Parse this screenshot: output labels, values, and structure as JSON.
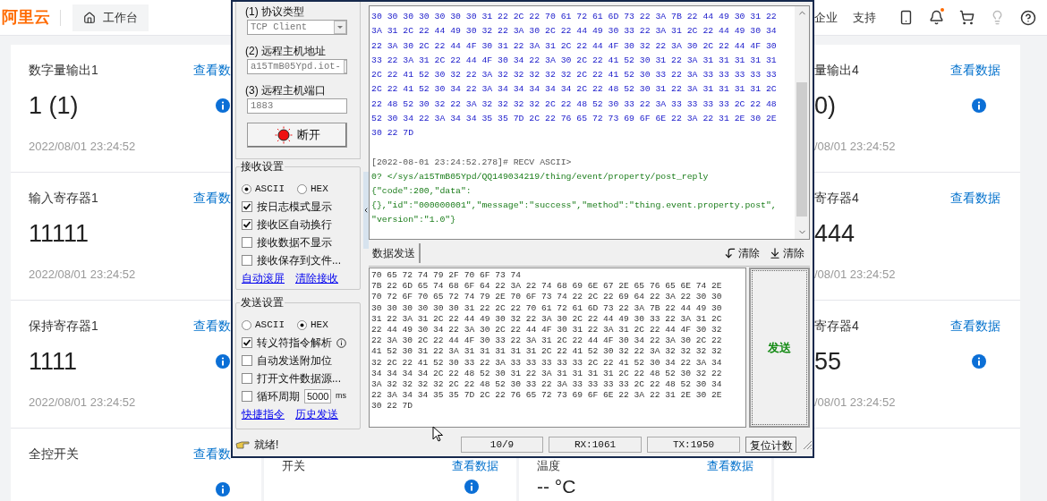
{
  "header": {
    "logo": "阿里云",
    "workbench": "工作台",
    "links": [
      "企业",
      "支持"
    ]
  },
  "left_cards": [
    {
      "title": "数字量输出1",
      "link": "查看数",
      "value": "1 (1)",
      "time": "2022/08/01 23:24:52",
      "info_icon": true
    },
    {
      "title": "输入寄存器1",
      "link": "查看数",
      "value": "11111",
      "time": "2022/08/01 23:24:52",
      "info_icon": false
    },
    {
      "title": "保持寄存器1",
      "link": "查看数",
      "value": "1111",
      "time": "2022/08/01 23:24:52",
      "info_icon": true
    },
    {
      "title": "全控开关",
      "link": "查看数",
      "info_icon": true
    }
  ],
  "right_cards": [
    {
      "title": "量输出4",
      "link": "查看数据",
      "value": "0)",
      "time": "/08/01 23:24:52",
      "info_icon": true
    },
    {
      "title": "寄存器4",
      "link": "查看数据",
      "value": "444",
      "time": "/08/01 23:24:52",
      "info_icon": false
    },
    {
      "title": "寄存器4",
      "link": "查看数据",
      "value": "55",
      "time": "/08/01 23:24:52",
      "info_icon": true
    }
  ],
  "bottom_cards": [
    {
      "title": "开关",
      "link": "查看数据",
      "info_icon": true
    },
    {
      "title": "温度",
      "link": "查看数据",
      "value": "-- °C",
      "info_icon": false
    }
  ],
  "tool": {
    "protocol_label": "(1) 协议类型",
    "protocol": "TCP Client",
    "host_label": "(2) 远程主机地址",
    "host": "a15TmB05Ypd.iot-",
    "port_label": "(3) 远程主机端口",
    "port": "1883",
    "connect_button": "断开",
    "lamp_on": true,
    "receive_settings": {
      "title": "接收设置",
      "modes": [
        {
          "label": "ASCII",
          "selected": true
        },
        {
          "label": "HEX",
          "selected": false
        }
      ],
      "options": [
        {
          "label": "按日志模式显示",
          "checked": true,
          "kind": "plain"
        },
        {
          "label": "接收区自动换行",
          "checked": true,
          "kind": "plain"
        },
        {
          "label": "接收数据不显示",
          "checked": false,
          "kind": "plain"
        },
        {
          "label": "接收保存到文件...",
          "checked": false,
          "kind": "plain"
        }
      ],
      "links": [
        "自动滚屏",
        "清除接收"
      ]
    },
    "send_settings": {
      "title": "发送设置",
      "modes": [
        {
          "label": "ASCII",
          "selected": false
        },
        {
          "label": "HEX",
          "selected": true
        }
      ],
      "options": [
        {
          "label": "转义符指令解析",
          "checked": true,
          "kind": "info"
        },
        {
          "label": "自动发送附加位",
          "checked": false,
          "kind": "plain"
        },
        {
          "label": "打开文件数据源...",
          "checked": false,
          "kind": "plain"
        },
        {
          "label": "循环周期",
          "checked": false,
          "kind": "period",
          "value": "5000",
          "unit": "ms"
        }
      ],
      "links": [
        "快捷指令",
        "历史发送"
      ]
    },
    "receive_log": {
      "hex_lines": [
        "30 30 30 30 30 30 30 31 22 2C 22 70 61 72 61 6D 73 22 3A 7B 22 44 49 30 31 22",
        "3A 31 2C 22 44 49 30 32 22 3A 30 2C 22 44 49 30 33 22 3A 31 2C 22 44 49 30 34",
        "22 3A 30 2C 22 44 4F 30 31 22 3A 31 2C 22 44 4F 30 32 22 3A 30 2C 22 44 4F 30",
        "33 22 3A 31 2C 22 44 4F 30 34 22 3A 30 2C 22 41 52 30 31 22 3A 31 31 31 31 31",
        "2C 22 41 52 30 32 22 3A 32 32 32 32 32 2C 22 41 52 30 33 22 3A 33 33 33 33 33",
        "2C 22 41 52 30 34 22 3A 34 34 34 34 34 2C 22 48 52 30 31 22 3A 31 31 31 31 2C",
        "22 48 52 30 32 22 3A 32 32 32 32 2C 22 48 52 30 33 22 3A 33 33 33 33 2C 22 48",
        "52 30 34 22 3A 34 34 35 35 7D 2C 22 76 65 72 73 69 6F 6E 22 3A 22 31 2E 30 2E",
        "30 22 7D"
      ],
      "header": "[2022-08-01 23:24:52.278]# RECV ASCII>",
      "ascii_lines": [
        "0? </sys/a15TmB05Ypd/QQ149034219/thing/event/property/post_reply",
        "{\"code\":200,\"data\":",
        "{},\"id\":\"000000001\",\"message\":\"success\",\"method\":\"thing.event.property.post\",",
        "\"version\":\"1.0\"}"
      ]
    },
    "send_tab": "数据发送",
    "clear_buttons": [
      {
        "label": "清除",
        "kind": "receive"
      },
      {
        "label": "清除",
        "kind": "send"
      }
    ],
    "send_lines": [
      "70 65 72 74 79 2F 70 6F 73 74",
      "7B 22 6D 65 74 68 6F 64 22 3A 22 74 68 69 6E 67 2E 65 76 65 6E 74 2E",
      "70 72 6F 70 65 72 74 79 2E 70 6F 73 74 22 2C 22 69 64 22 3A 22 30 30",
      "30 30 30 30 30 30 31 22 2C 22 70 61 72 61 6D 73 22 3A 7B 22 44 49 30",
      "31 22 3A 31 2C 22 44 49 30 32 22 3A 30 2C 22 44 49 30 33 22 3A 31 2C",
      "22 44 49 30 34 22 3A 30 2C 22 44 4F 30 31 22 3A 31 2C 22 44 4F 30 32",
      "22 3A 30 2C 22 44 4F 30 33 22 3A 31 2C 22 44 4F 30 34 22 3A 30 2C 22",
      "41 52 30 31 22 3A 31 31 31 31 31 2C 22 41 52 30 32 22 3A 32 32 32 32",
      "32 2C 22 41 52 30 33 22 3A 33 33 33 33 33 2C 22 41 52 30 34 22 3A 34",
      "34 34 34 34 2C 22 48 52 30 31 22 3A 31 31 31 31 2C 22 48 52 30 32 22",
      "3A 32 32 32 32 2C 22 48 52 30 33 22 3A 33 33 33 33 2C 22 48 52 30 34",
      "22 3A 34 34 35 35 7D 2C 22 76 65 72 73 69 6F 6E 22 3A 22 31 2E 30 2E",
      "30 22 7D"
    ],
    "send_button": "发送",
    "status": {
      "text": "就绪!",
      "cells": [
        "10/9",
        "RX:1061",
        "TX:1950"
      ],
      "reset_button": "复位计数"
    }
  }
}
